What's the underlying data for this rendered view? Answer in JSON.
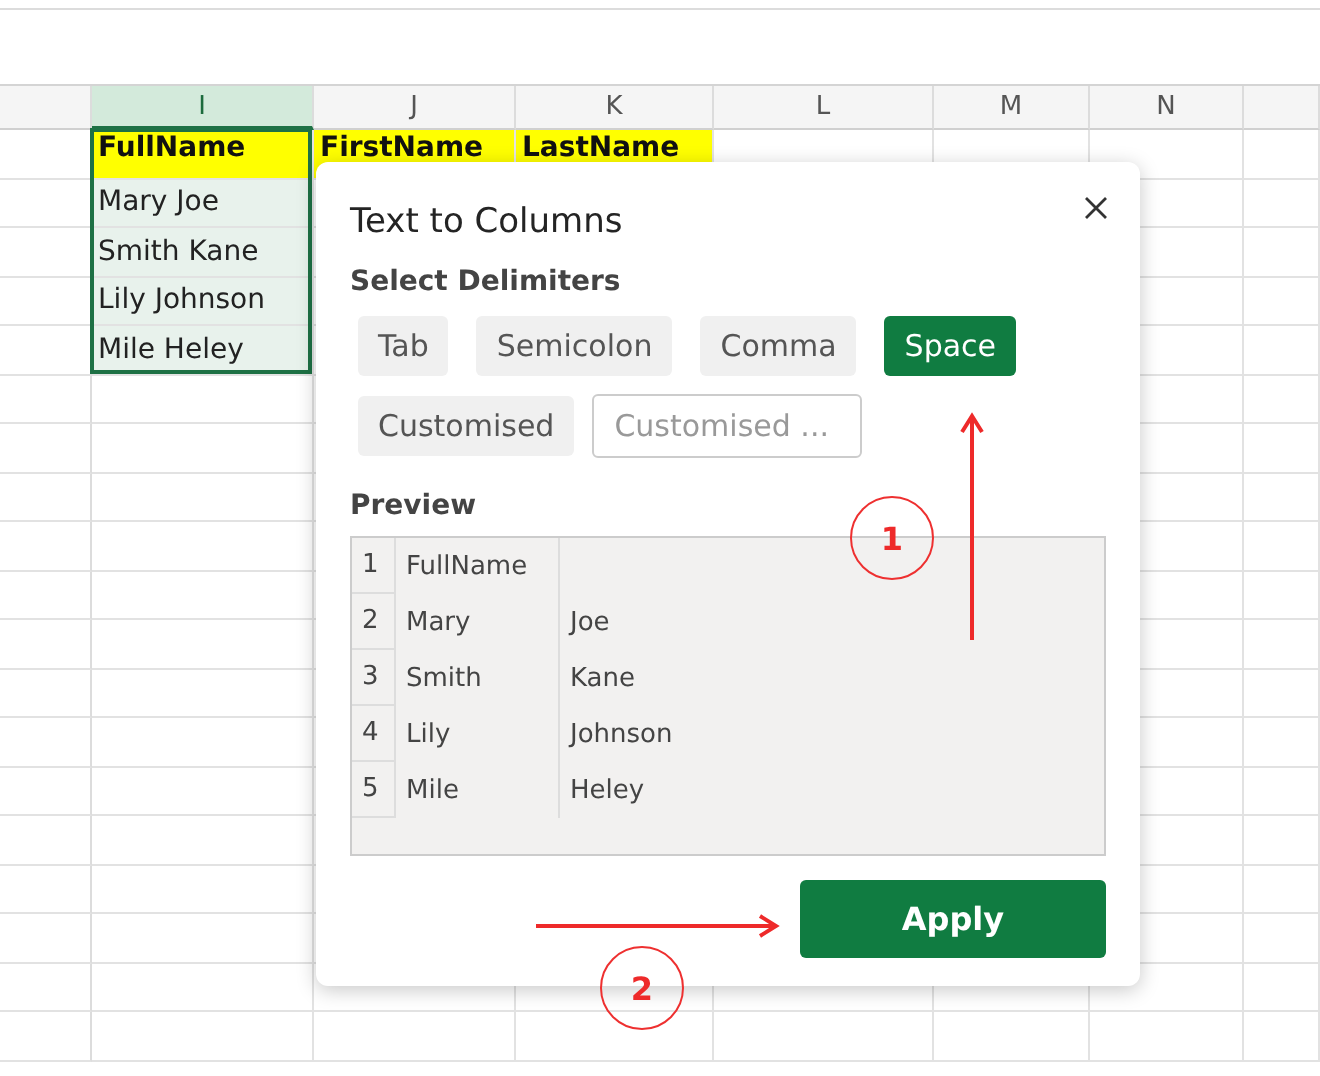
{
  "sheet": {
    "columns": [
      {
        "label": "I",
        "selected": true
      },
      {
        "label": "J",
        "selected": false
      },
      {
        "label": "K",
        "selected": false
      },
      {
        "label": "L",
        "selected": false
      },
      {
        "label": "M",
        "selected": false
      },
      {
        "label": "N",
        "selected": false
      }
    ],
    "rows": [
      {
        "cells": [
          {
            "text": "FullName",
            "highlighted": true,
            "selected": true
          },
          {
            "text": "FirstName",
            "highlighted": true
          },
          {
            "text": "LastName",
            "highlighted": true
          }
        ]
      },
      {
        "cells": [
          {
            "text": "Mary Joe",
            "highlighted": false,
            "selected": true
          }
        ]
      },
      {
        "cells": [
          {
            "text": "Smith Kane",
            "highlighted": false,
            "selected": true
          }
        ]
      },
      {
        "cells": [
          {
            "text": "Lily Johnson",
            "highlighted": false,
            "selected": true
          }
        ]
      },
      {
        "cells": [
          {
            "text": "Mile Heley",
            "highlighted": false,
            "selected": true
          }
        ]
      }
    ]
  },
  "dialog": {
    "title": "Text to Columns",
    "section": "Select Delimiters",
    "delimiters": [
      {
        "label": "Tab",
        "selected": false
      },
      {
        "label": "Semicolon",
        "selected": false
      },
      {
        "label": "Comma",
        "selected": false
      },
      {
        "label": "Space",
        "selected": true
      },
      {
        "label": "Customised",
        "selected": false
      }
    ],
    "custom_field": {
      "placeholder": "Customised ..."
    },
    "preview_label": "Preview",
    "preview_rows": [
      {
        "number": "1",
        "column_1": "FullName"
      },
      {
        "number": "2",
        "column_1": "Mary",
        "column_2": "Joe"
      },
      {
        "number": "3",
        "column_1": "Smith",
        "column_2": "Kane"
      },
      {
        "number": "4",
        "column_1": "Lily",
        "column_2": "Johnson"
      },
      {
        "number": "5",
        "column_1": "Mile",
        "column_2": "Heley"
      }
    ],
    "apply": "Apply"
  },
  "annotations": [
    {
      "label": "1"
    },
    {
      "label": "2"
    }
  ]
}
